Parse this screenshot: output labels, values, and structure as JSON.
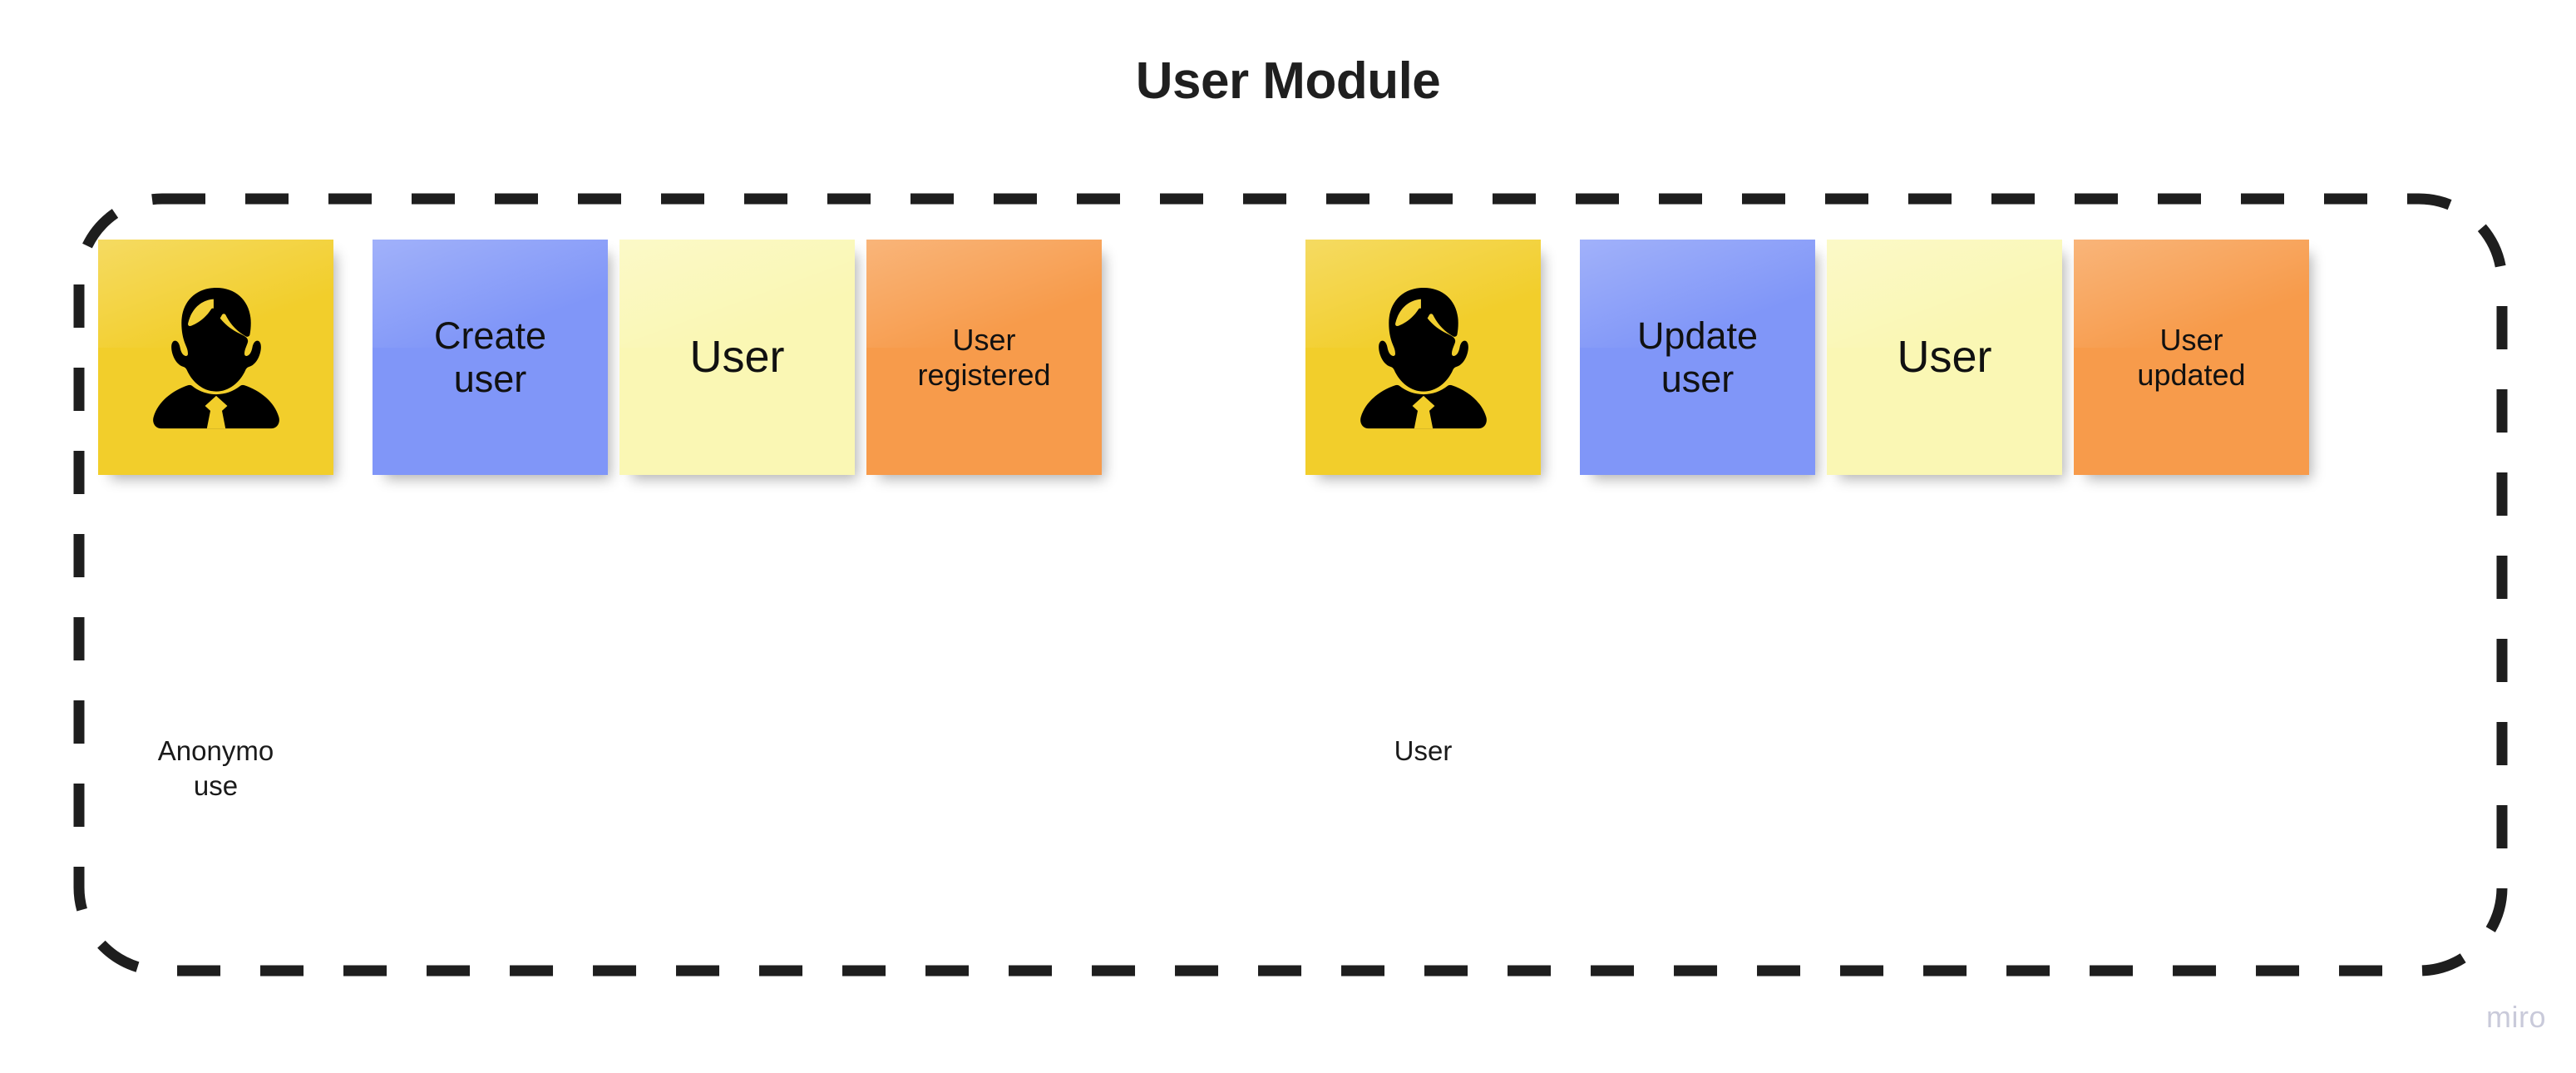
{
  "board": {
    "title": "User Module",
    "watermark": "miro",
    "background_color": "#ffffff",
    "frame": {
      "style": "dashed",
      "color": "#1e1e1e",
      "stroke_width": 13,
      "dash": 52,
      "gap": 48,
      "corner_radius": 100
    }
  },
  "palette": {
    "actor": "#F2CE2B",
    "command": "#8096F8",
    "aggregate": "#FAF7B4",
    "event": "#F79B4B",
    "text": "#111111",
    "title": "#1f1f1f",
    "watermark": "#c9cada"
  },
  "flows": [
    {
      "name": "register-user-flow",
      "actor": {
        "icon": "user-avatar-icon",
        "color": "#F2CE2B",
        "label": "Anonymo\nuse"
      },
      "notes": [
        {
          "kind": "command",
          "text": "Create\nuser",
          "color": "#8096F8",
          "size": "md"
        },
        {
          "kind": "aggregate",
          "text": "User",
          "color": "#FAF7B4",
          "size": "lg"
        },
        {
          "kind": "event",
          "text": "User\nregistered",
          "color": "#F79B4B",
          "size": "sm"
        }
      ]
    },
    {
      "name": "update-user-flow",
      "actor": {
        "icon": "user-avatar-icon",
        "color": "#F2CE2B",
        "label": "User"
      },
      "notes": [
        {
          "kind": "command",
          "text": "Update\nuser",
          "color": "#8096F8",
          "size": "md"
        },
        {
          "kind": "aggregate",
          "text": "User",
          "color": "#FAF7B4",
          "size": "lg"
        },
        {
          "kind": "event",
          "text": "User\nupdated",
          "color": "#F79B4B",
          "size": "sm"
        }
      ]
    }
  ]
}
